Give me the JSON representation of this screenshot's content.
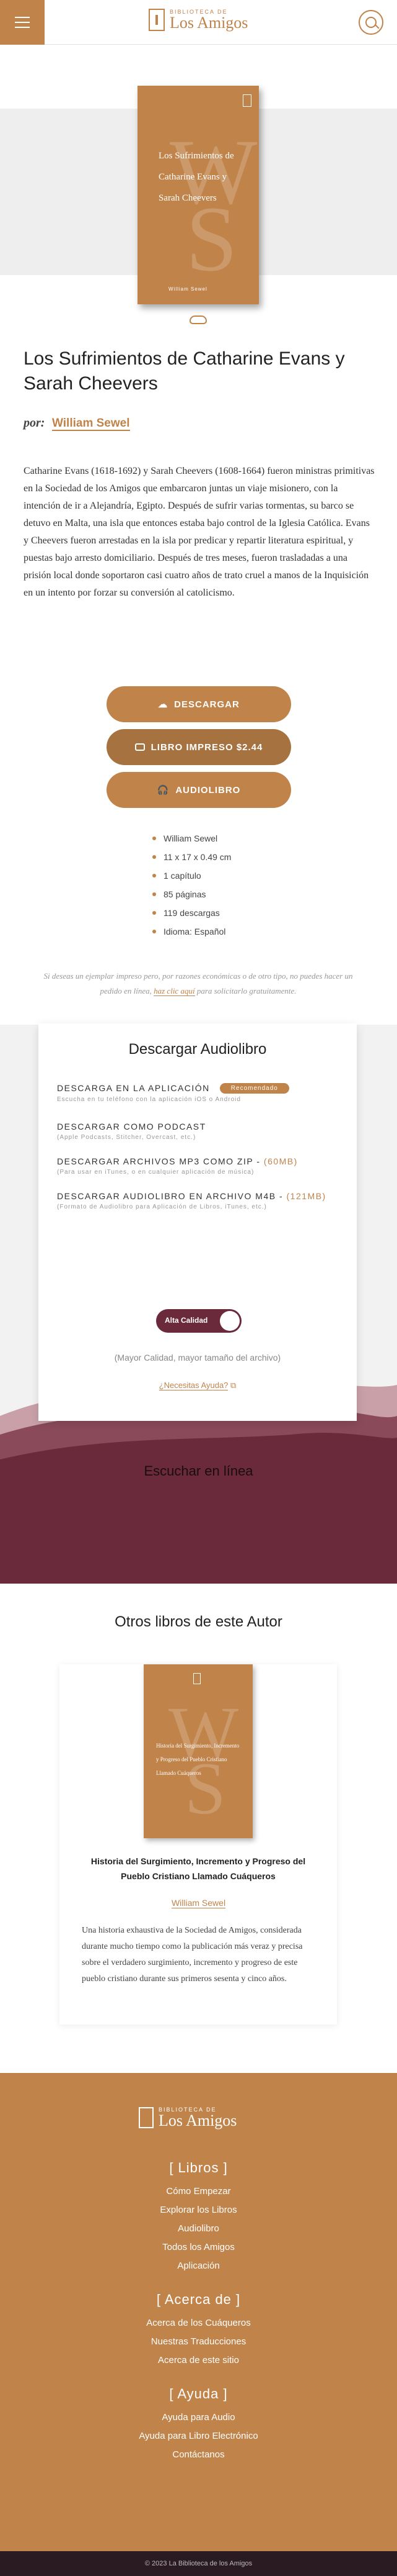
{
  "header": {
    "logo_small": "BIBLIOTECA DE",
    "logo_big": "Los Amigos"
  },
  "book": {
    "cover_title": "Los Sufrimientos de Catharine Evans y Sarah Cheevers",
    "cover_author": "William Sewel",
    "title": "Los Sufrimientos de Catharine Evans y Sarah Cheevers",
    "by_label": "por:",
    "author": "William Sewel",
    "description": "Catharine Evans (1618-1692) y Sarah Cheevers (1608-1664) fueron ministras primitivas en la Sociedad de los Amigos que embarcaron juntas un viaje misionero, con la intención de ir a Alejandría, Egipto. Después de sufrir varias tormentas, su barco se detuvo en Malta, una isla que entonces estaba bajo control de la Iglesia Católica. Evans y Cheevers fueron arrestadas en la isla por predicar y repartir literatura espiritual, y puestas bajo arresto domiciliario. Después de tres meses, fueron trasladadas a una prisión local donde soportaron casi cuatro años de trato cruel a manos de la Inquisición en un intento por forzar su conversión al catolicismo."
  },
  "buttons": {
    "download": "DESCARGAR",
    "print": "LIBRO IMPRESO $2.44",
    "audio": "AUDIOLIBRO"
  },
  "details": [
    "William Sewel",
    "11 x 17 x 0.49 cm",
    "1 capítulo",
    "85 páginas",
    "119 descargas",
    "Idioma: Español"
  ],
  "note": {
    "text": "Si deseas un ejemplar impreso pero, por razones económicas o de otro tipo, no puedes hacer un pedido en línea,",
    "link": "haz clic aquí",
    "tail": "para solicitarlo gratuitamente."
  },
  "audio": {
    "heading": "Descargar Audiolibro",
    "options": [
      {
        "title": "DESCARGA EN LA APLICACIÓN",
        "badge": "Recomendado",
        "sub": "Escucha en tu teléfono con la aplicación iOS o Android"
      },
      {
        "title": "DESCARGAR COMO PODCAST",
        "sub": "(Apple Podcasts, Stitcher, Overcast, etc.)"
      },
      {
        "title": "DESCARGAR ARCHIVOS MP3 COMO ZIP -",
        "size": "(60MB)",
        "sub": "(Para usar en iTunes, o en cualquier aplicación de música)"
      },
      {
        "title": "DESCARGAR AUDIOLIBRO EN ARCHIVO M4B -",
        "size": "(121MB)",
        "sub": "(Formato de Audiolibro para Aplicación de Libros, iTunes, etc.)"
      }
    ],
    "toggle_label": "Alta Calidad",
    "quality_note": "(Mayor Calidad, mayor tamaño del archivo)",
    "help": "¿Necesitas Ayuda?",
    "listen": "Escuchar en línea"
  },
  "other": {
    "heading": "Otros libros de este Autor",
    "title": "Historia del Surgimiento, Incremento y Progreso del Pueblo Cristiano Llamado Cuáqueros",
    "author": "William Sewel",
    "description": "Una historia exhaustiva de la Sociedad de Amigos, considerada durante mucho tiempo como la publicación más veraz y precisa sobre el verdadero surgimiento, incremento y progreso de este pueblo cristiano durante sus primeros sesenta y cinco años."
  },
  "footer": {
    "logo_small": "BIBLIOTECA DE",
    "logo_big": "Los Amigos",
    "books_heading": "[ Libros ]",
    "books_links": [
      "Cómo Empezar",
      "Explorar los Libros",
      "Audiolibro",
      "Todos los Amigos",
      "Aplicación"
    ],
    "about_heading": "[ Acerca de ]",
    "about_links": [
      "Acerca de los Cuáqueros",
      "Nuestras Traducciones",
      "Acerca de este sitio"
    ],
    "help_heading": "[ Ayuda ]",
    "help_links": [
      "Ayuda para Audio",
      "Ayuda para Libro Electrónico",
      "Contáctanos"
    ],
    "copyright": "© 2023 La Biblioteca de los Amigos"
  }
}
